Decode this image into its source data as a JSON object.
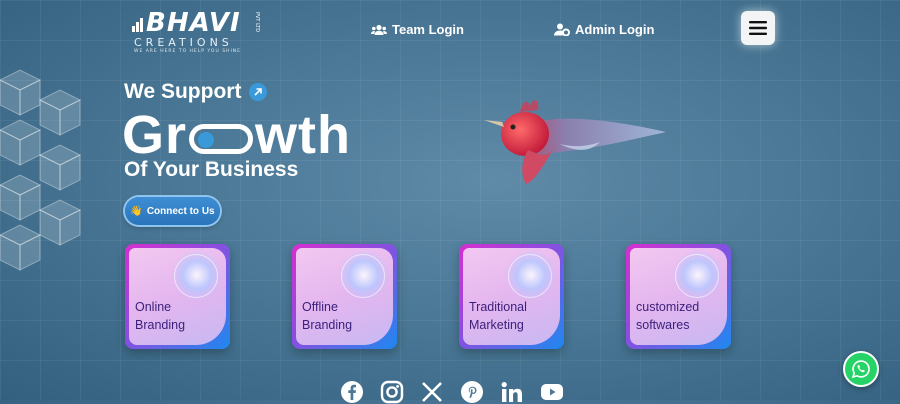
{
  "brand": {
    "name": "BHAVI",
    "sub": "CREATIONS",
    "tagline": "WE ARE HERE TO HELP YOU SHINE",
    "pvt": "PVT LTD"
  },
  "nav": {
    "team_login": "Team Login",
    "admin_login": "Admin Login"
  },
  "hero": {
    "line1": "We Support",
    "growth_start": "Gr",
    "growth_end": "wth",
    "line3": "Of Your Business",
    "cta_label": "Connect to Us",
    "cta_emoji": "👋"
  },
  "services": [
    {
      "label": "Online\nBranding"
    },
    {
      "label": "Offline\nBranding"
    },
    {
      "label": "Traditional\nMarketing"
    },
    {
      "label": "customized\nsoftwares"
    }
  ],
  "socials": [
    "facebook",
    "instagram",
    "x",
    "pinterest",
    "linkedin",
    "youtube"
  ],
  "colors": {
    "accent": "#3a9ad9",
    "card_gradient_start": "#d72fd0",
    "card_gradient_end": "#1e88f0",
    "whatsapp": "#25d366"
  }
}
